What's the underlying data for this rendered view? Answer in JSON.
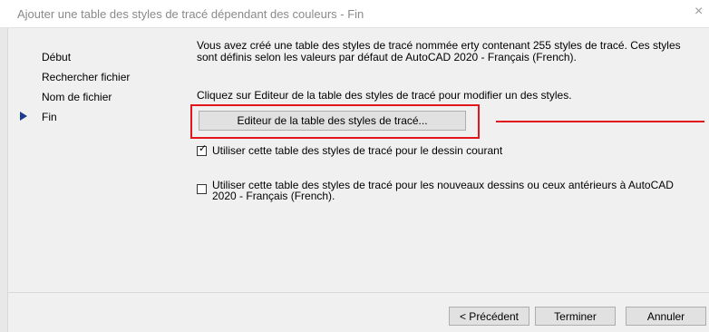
{
  "window": {
    "title": "Ajouter une table des styles de tracé dépendant des couleurs - Fin",
    "close_glyph": "×"
  },
  "nav": {
    "items": [
      {
        "label": "Début"
      },
      {
        "label": "Rechercher fichier"
      },
      {
        "label": "Nom de fichier"
      },
      {
        "label": "Fin"
      }
    ],
    "current": "Fin"
  },
  "content": {
    "paragraph1": "Vous avez créé une table des styles de tracé nommée erty contenant 255 styles de tracé. Ces styles sont définis selon les valeurs par défaut de AutoCAD 2020 - Français (French).",
    "paragraph2": "Cliquez sur Editeur de la table des styles de tracé pour modifier un des styles.",
    "editor_button": "Editeur de la table des styles de tracé...",
    "checkbox_current": {
      "label": "Utiliser cette table des styles de tracé pour le dessin courant",
      "checked": true
    },
    "checkbox_new": {
      "label": "Utiliser cette table des styles de tracé pour les nouveaux dessins ou ceux antérieurs à AutoCAD 2020 - Français (French).",
      "checked": false
    }
  },
  "footer": {
    "back_label": "< Précédent",
    "finish_label": "Terminer",
    "cancel_label": "Annuler"
  },
  "colors": {
    "highlight": "#e3161c",
    "nav_arrow": "#1c3c8c",
    "dialog_bg": "#f0f0f0"
  }
}
